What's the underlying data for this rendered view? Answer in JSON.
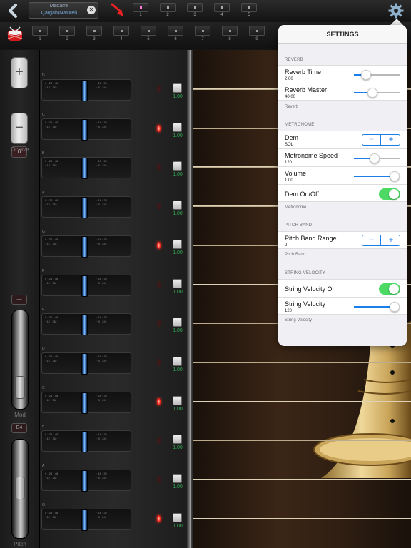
{
  "topbar": {
    "maqam_title": "Maqams",
    "maqam_value": "Çargah(Naturel)",
    "slots": [
      "1",
      "2",
      "3",
      "4",
      "5"
    ],
    "active_slot_color": "#ff7ad9"
  },
  "presets": [
    "1",
    "2",
    "3",
    "4",
    "5",
    "6",
    "7",
    "8",
    "9"
  ],
  "left_panel": {
    "octave_plus": "+",
    "octave_value": "0",
    "octave_minus": "−",
    "octave_label": "Octave",
    "mod_top": "—",
    "mod_label": "Mod",
    "pitch_top": "E4",
    "pitch_label": "Pitch"
  },
  "mixer_rows": [
    {
      "note": "D",
      "value": "1.00",
      "led": false
    },
    {
      "note": "C",
      "value": "1.00",
      "led": true
    },
    {
      "note": "B",
      "value": "1.00",
      "led": false
    },
    {
      "note": "A",
      "value": "1.00",
      "led": false
    },
    {
      "note": "G",
      "value": "1.00",
      "led": true
    },
    {
      "note": "F",
      "value": "1.00",
      "led": false
    },
    {
      "note": "E",
      "value": "1.00",
      "led": false
    },
    {
      "note": "D",
      "value": "1.00",
      "led": false
    },
    {
      "note": "C",
      "value": "1.00",
      "led": true
    },
    {
      "note": "B",
      "value": "1.00",
      "led": false
    },
    {
      "note": "A",
      "value": "1.00",
      "led": false
    },
    {
      "note": "G",
      "value": "1.00",
      "led": true
    }
  ],
  "settings": {
    "title": "SETTINGS",
    "reverb": {
      "header": "REVERB",
      "reverb_time_label": "Reverb Time",
      "reverb_time_value": "2.00",
      "reverb_time_level": 0.27,
      "reverb_master_label": "Reverb Master",
      "reverb_master_value": "40.00",
      "reverb_master_level": 0.4,
      "footer": "Reverb"
    },
    "metronome": {
      "header": "METRONOME",
      "dem_label": "Dem",
      "dem_value": "SOL",
      "speed_label": "Metronome Speed",
      "speed_value": "120",
      "speed_level": 0.45,
      "volume_label": "Volume",
      "volume_value": "1.00",
      "volume_level": 1.0,
      "onoff_label": "Dem On/Off",
      "onoff_state": true,
      "footer": "Metronome"
    },
    "pitch_band": {
      "header": "PITCH BAND",
      "range_label": "Pitch Band Range",
      "range_value": "2",
      "footer": "Pitch Band"
    },
    "string_velocity": {
      "header": "STRING VELOCITY",
      "on_label": "String Velocity On",
      "on_state": true,
      "velocity_label": "String Velocity",
      "velocity_value": "120",
      "velocity_level": 0.95,
      "footer": "String Velocity"
    },
    "stepper_minus": "−",
    "stepper_plus": "+"
  },
  "colors": {
    "accent": "#1a7ee8",
    "toggle_on": "#4cd964",
    "led_on": "#ff2a1a",
    "fader": "#4a8ad8"
  }
}
